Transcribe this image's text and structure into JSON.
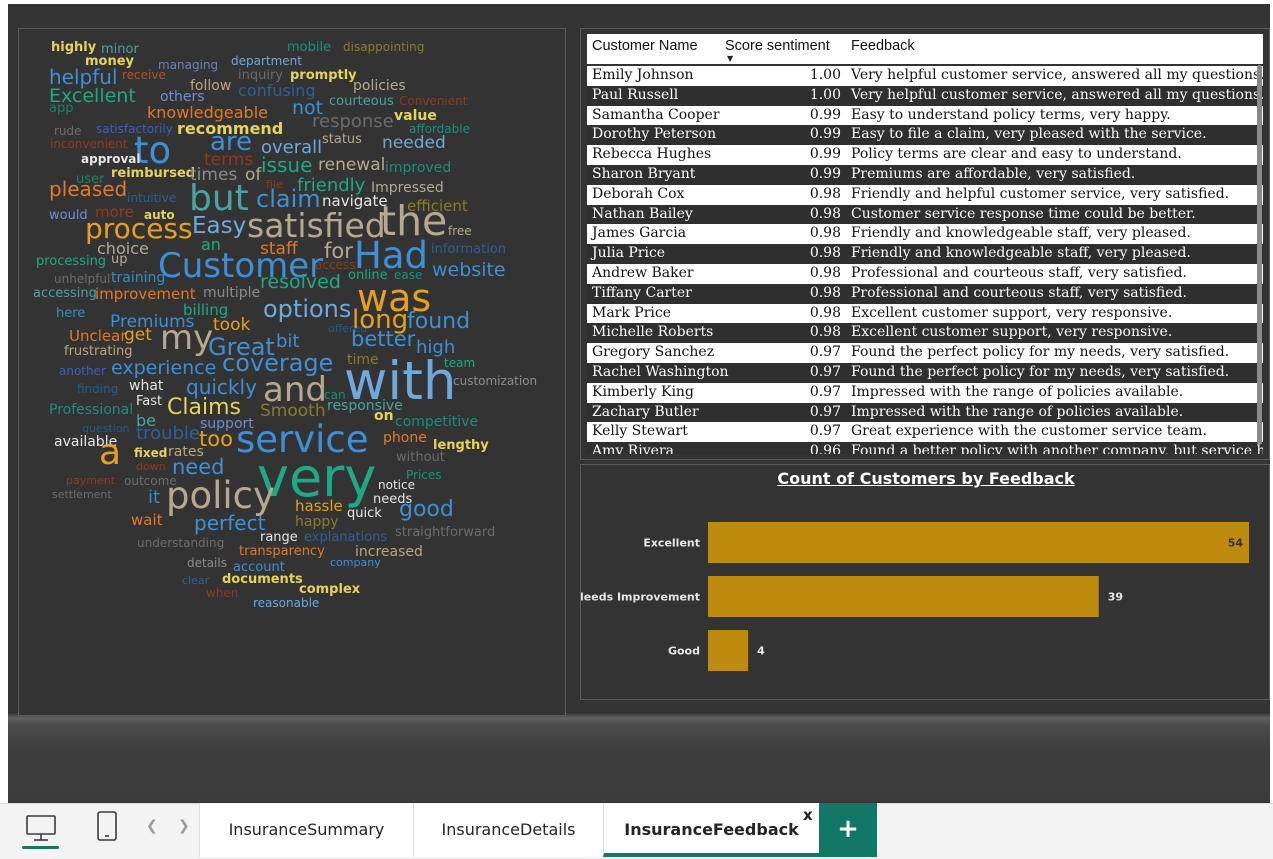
{
  "word_cloud": {
    "words": [
      "highly",
      "minor",
      "money",
      "mobile",
      "disappointing",
      "managing",
      "department",
      "helpful",
      "receive",
      "inquiry",
      "promptly",
      "Excellent",
      "follow",
      "policies",
      "others",
      "confusing",
      "app",
      "knowledgeable",
      "courteous",
      "Convenient",
      "not",
      "rude",
      "satisfactorily",
      "recommend",
      "value",
      "response",
      "inconvenient",
      "affordable",
      "are",
      "status",
      "to",
      "overall",
      "needed",
      "approval",
      "terms",
      "issue",
      "renewal",
      "improved",
      "user",
      "reimbursed",
      "times",
      "of",
      "friendly",
      "pleased",
      "file",
      "Impressed",
      "but",
      "claim",
      "intuitive",
      "navigate",
      "efficient",
      "would",
      "more",
      "auto",
      "the",
      "process",
      "Easy",
      "satisfied",
      "free",
      "choice",
      "an",
      "staff",
      "for",
      "Had",
      "information",
      "processing",
      "up",
      "Customer",
      "access",
      "online",
      "ease",
      "website",
      "unhelpful",
      "training",
      "resolved",
      "accessing",
      "improvement",
      "multiple",
      "was",
      "billing",
      "here",
      "options",
      "Premiums",
      "took",
      "offered",
      "long",
      "found",
      "Unclear",
      "get",
      "my",
      "Great",
      "bit",
      "better",
      "frustrating",
      "high",
      "time",
      "team",
      "another",
      "experience",
      "coverage",
      "with",
      "customization",
      "what",
      "finding",
      "quickly",
      "and",
      "Fast",
      "can",
      "Professional",
      "Claims",
      "Smooth",
      "responsive",
      "be",
      "on",
      "competitive",
      "question",
      "support",
      "trouble",
      "phone",
      "available",
      "too",
      "service",
      "lengthy",
      "a",
      "fixed",
      "rates",
      "without",
      "down",
      "need",
      "very",
      "Prices",
      "payment",
      "outcome",
      "notice",
      "settlement",
      "it",
      "policy",
      "needs",
      "hassle",
      "good",
      "wait",
      "perfect",
      "happy",
      "quick",
      "straightforward",
      "explanations",
      "understanding",
      "range",
      "transparency",
      "increased",
      "details",
      "account",
      "company",
      "clear",
      "documents",
      "complex",
      "when",
      "reasonable"
    ]
  },
  "table": {
    "headers": {
      "name": "Customer Name",
      "score": "Score sentiment",
      "feedback": "Feedback"
    },
    "sort_indicator": "sort-descending-icon",
    "rows": [
      {
        "name": "Emily Johnson",
        "score": "1.00",
        "feedback": "Very helpful customer service, answered all my questions."
      },
      {
        "name": "Paul Russell",
        "score": "1.00",
        "feedback": "Very helpful customer service, answered all my questions."
      },
      {
        "name": "Samantha Cooper",
        "score": "0.99",
        "feedback": "Easy to understand policy terms, very happy."
      },
      {
        "name": "Dorothy Peterson",
        "score": "0.99",
        "feedback": "Easy to file a claim, very pleased with the service."
      },
      {
        "name": "Rebecca Hughes",
        "score": "0.99",
        "feedback": "Policy terms are clear and easy to understand."
      },
      {
        "name": "Sharon Bryant",
        "score": "0.99",
        "feedback": "Premiums are affordable, very satisfied."
      },
      {
        "name": "Deborah Cox",
        "score": "0.98",
        "feedback": "Friendly and helpful customer service, very satisfied."
      },
      {
        "name": "Nathan Bailey",
        "score": "0.98",
        "feedback": "Customer service response time could be better."
      },
      {
        "name": "James Garcia",
        "score": "0.98",
        "feedback": "Friendly and knowledgeable staff, very pleased."
      },
      {
        "name": "Julia Price",
        "score": "0.98",
        "feedback": "Friendly and knowledgeable staff, very pleased."
      },
      {
        "name": "Andrew Baker",
        "score": "0.98",
        "feedback": "Professional and courteous staff, very satisfied."
      },
      {
        "name": "Tiffany Carter",
        "score": "0.98",
        "feedback": "Professional and courteous staff, very satisfied."
      },
      {
        "name": "Mark Price",
        "score": "0.98",
        "feedback": "Excellent customer support, very responsive."
      },
      {
        "name": "Michelle Roberts",
        "score": "0.98",
        "feedback": "Excellent customer support, very responsive."
      },
      {
        "name": "Gregory Sanchez",
        "score": "0.97",
        "feedback": "Found the perfect policy for my needs, very satisfied."
      },
      {
        "name": "Rachel Washington",
        "score": "0.97",
        "feedback": "Found the perfect policy for my needs, very satisfied."
      },
      {
        "name": "Kimberly King",
        "score": "0.97",
        "feedback": "Impressed with the range of policies available."
      },
      {
        "name": "Zachary Butler",
        "score": "0.97",
        "feedback": "Impressed with the range of policies available."
      },
      {
        "name": "Kelly Stewart",
        "score": "0.97",
        "feedback": "Great experience with the customer service team."
      },
      {
        "name": "Amy Rivera",
        "score": "0.96",
        "feedback": "Found a better policy with another company, but service here"
      }
    ]
  },
  "chart_data": {
    "type": "bar",
    "orientation": "horizontal",
    "title": "Count of Customers by Feedback",
    "categories": [
      "Excellent",
      "Needs Improvement",
      "Good"
    ],
    "values": [
      54,
      39,
      4
    ],
    "bar_color": "#bf8b0f",
    "xlim": [
      0,
      54
    ],
    "grid": false,
    "legend": "none"
  },
  "tabs": {
    "pages": [
      "InsuranceSummary",
      "InsuranceDetails",
      "InsuranceFeedback"
    ],
    "active_index": 2,
    "close_label": "x",
    "add_label": "+",
    "accent_color": "#117865"
  },
  "view_controls": {
    "desktop_icon": "desktop-view-icon",
    "mobile_icon": "mobile-view-icon",
    "prev_icon": "chevron-left-icon",
    "next_icon": "chevron-right-icon"
  }
}
